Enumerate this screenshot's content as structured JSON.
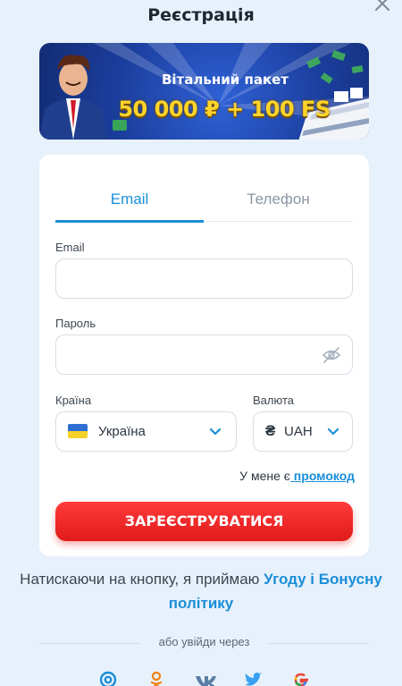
{
  "header": {
    "title": "Реєстрація",
    "close_icon": "close-icon"
  },
  "banner": {
    "title": "Вітальний пакет",
    "amount": "50 000 ₽ + 100 FS"
  },
  "tabs": [
    {
      "label": "Email",
      "active": true
    },
    {
      "label": "Телефон",
      "active": false
    }
  ],
  "form": {
    "email": {
      "label": "Email",
      "value": "",
      "placeholder": ""
    },
    "password": {
      "label": "Пароль",
      "value": "",
      "placeholder": "",
      "icon": "eye-off-icon"
    },
    "country": {
      "label": "Країна",
      "value": "Україна",
      "flag": "ukraine-flag"
    },
    "currency": {
      "label": "Валюта",
      "symbol": "₴",
      "value": "UAH"
    }
  },
  "promo": {
    "text": "У мене є",
    "link": " промокод"
  },
  "submit_label": "ЗАРЕЄСТРУВАТИСЯ",
  "terms": {
    "text": "Натискаючи на кнопку, я приймаю ",
    "link": "Угоду і Бонусну політику"
  },
  "divider_text": "або увійди через",
  "socials": [
    {
      "name": "mail-ru-icon",
      "glyph": "@",
      "color": "#1b8ed8"
    },
    {
      "name": "odnoklassniki-icon",
      "glyph": "ok",
      "color": "#f2871f"
    },
    {
      "name": "vk-icon",
      "glyph": "vk",
      "color": "#5a7ea6"
    },
    {
      "name": "twitter-icon",
      "glyph": "tw",
      "color": "#39a1f2"
    },
    {
      "name": "google-icon",
      "glyph": "G",
      "color": "#ea4335"
    }
  ],
  "colors": {
    "accent": "#1b8ed8",
    "button": "#e11a1a",
    "background": "#e7f1fb",
    "banner_gold": "#ffd42a"
  }
}
